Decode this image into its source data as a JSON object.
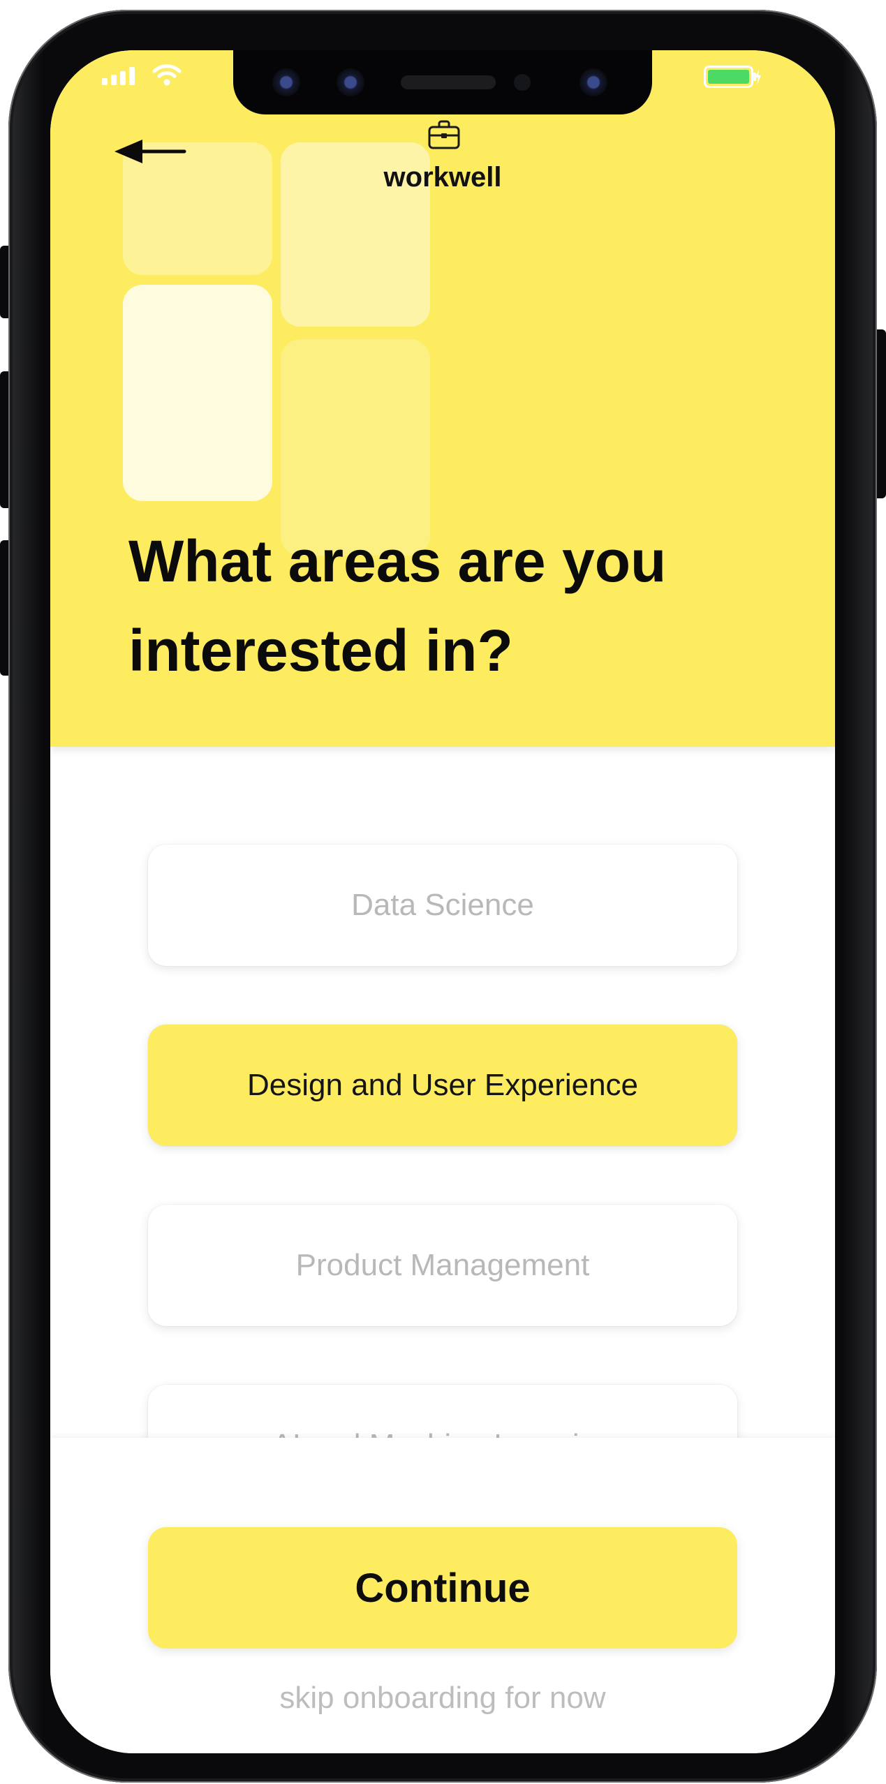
{
  "app": {
    "brand_name": "workwell"
  },
  "status_bar": {
    "battery_color": "#4cd964"
  },
  "header": {
    "title": "What areas are you interested in?"
  },
  "options": [
    {
      "label": "Data Science",
      "selected": false
    },
    {
      "label": "Design and User Experience",
      "selected": true
    },
    {
      "label": "Product Management",
      "selected": false
    },
    {
      "label": "AI and Machine Learning",
      "selected": false
    }
  ],
  "footer": {
    "continue_label": "Continue",
    "skip_label": "skip onboarding for now"
  },
  "colors": {
    "accent": "#fdec60",
    "text_primary": "#111111",
    "text_muted": "#b8b8b8"
  },
  "icons": {
    "back": "arrow-left-icon",
    "brand": "briefcase-icon"
  }
}
